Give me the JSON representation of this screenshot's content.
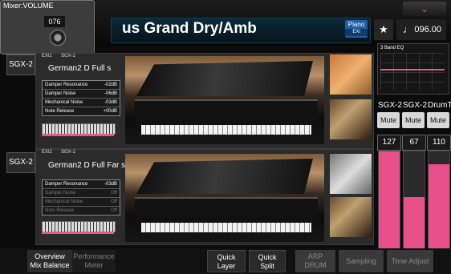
{
  "header": {
    "program_title": "us Grand Dry/Amb",
    "badge_top": "Piano",
    "badge_bottom": "EXi",
    "tempo": "096.00",
    "star_glyph": "★",
    "tempo_glyph": "♩",
    "chevron_glyph": "⌄"
  },
  "mixer_popup": {
    "title": "Mixer:VOLUME",
    "value": "076"
  },
  "layers": [
    {
      "tag": "SGX-2",
      "exi": "EXi1",
      "engine": "SGX-2",
      "program_name": "German2 D Full s",
      "params": [
        {
          "name": "Damper Resonance",
          "value": "-02dB",
          "dim": false
        },
        {
          "name": "Damper Noise",
          "value": "-06dB",
          "dim": false
        },
        {
          "name": "Mechanical Noise",
          "value": "-03dB",
          "dim": false
        },
        {
          "name": "Note Release",
          "value": "+00dB",
          "dim": false
        }
      ]
    },
    {
      "tag": "SGX-2",
      "exi": "EXi2",
      "engine": "SGX-2",
      "program_name": "German2 D Full Far s",
      "params": [
        {
          "name": "Damper Resonance",
          "value": "-03dB",
          "dim": false
        },
        {
          "name": "Damper Noise",
          "value": "Off",
          "dim": true
        },
        {
          "name": "Mechanical Noise",
          "value": "Off",
          "dim": true
        },
        {
          "name": "Note Release",
          "value": "Off",
          "dim": true
        }
      ]
    }
  ],
  "eq": {
    "title": "3 Band EQ"
  },
  "channels": [
    {
      "name": "SGX-2",
      "mute": "Mute",
      "volume": "127",
      "level": 1.0
    },
    {
      "name": "SGX-2",
      "mute": "Mute",
      "volume": "67",
      "level": 0.53
    },
    {
      "name": "DrumT",
      "mute": "Mute",
      "volume": "110",
      "level": 0.87
    }
  ],
  "tabs": [
    {
      "line1": "Overview",
      "line2": "Mix Balance"
    },
    {
      "line1": "Performance",
      "line2": "Meter"
    },
    {
      "line1": "Quick",
      "line2": "Layer"
    },
    {
      "line1": "Quick",
      "line2": "Split"
    },
    {
      "line1": "ARP",
      "line2": "DRUM"
    },
    {
      "line1": "Sampling",
      "line2": ""
    },
    {
      "line1": "Tone Adjust",
      "line2": ""
    }
  ],
  "colors": {
    "accent": "#e8508a",
    "badge": "#1f5fa8"
  }
}
